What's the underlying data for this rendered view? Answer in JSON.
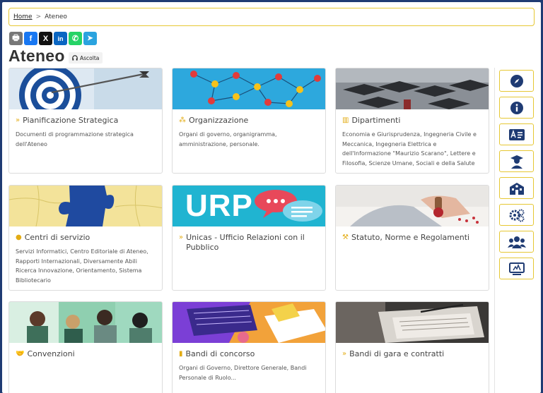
{
  "breadcrumb": {
    "home": "Home",
    "separator": ">",
    "current": "Ateneo"
  },
  "share": [
    {
      "icon": "print-icon",
      "glyph": "🖶",
      "color": "#777777"
    },
    {
      "icon": "facebook-icon",
      "glyph": "f",
      "color": "#1877f2"
    },
    {
      "icon": "x-icon",
      "glyph": "X",
      "color": "#111111"
    },
    {
      "icon": "linkedin-icon",
      "glyph": "in",
      "color": "#0a66c2"
    },
    {
      "icon": "whatsapp-icon",
      "glyph": "✆",
      "color": "#25d366"
    },
    {
      "icon": "telegram-icon",
      "glyph": "➤",
      "color": "#2aa3df"
    }
  ],
  "page_title": "Ateneo",
  "listen_label": "Ascolta",
  "cards": [
    {
      "title": "Pianificazione Strategica",
      "icon": "double-chevron-icon",
      "desc": "Documenti di programmazione strategica dell'Ateneo"
    },
    {
      "title": "Organizzazione",
      "icon": "sitemap-icon",
      "desc": "Organi di governo, organigramma, amministrazione, personale."
    },
    {
      "title": "Dipartimenti",
      "icon": "building-icon",
      "desc": "Economia e Giurisprudenza, Ingegneria Civile e Meccanica, Ingegneria Elettrica e dell'Informazione \"Maurizio Scarano\", Lettere e Filosofia, Scienze Umane, Sociali e della Salute"
    },
    {
      "title": "Centri di servizio",
      "icon": "coin-icon",
      "desc": "Servizi Informatici, Centro Editoriale di Ateneo, Rapporti Internazionali, Diversamente Abili Ricerca Innovazione, Orientamento, Sistema Bibliotecario"
    },
    {
      "title": "Unicas - Ufficio Relazioni con il Pubblico",
      "icon": "double-chevron-icon",
      "desc": ""
    },
    {
      "title": "Statuto, Norme e Regolamenti",
      "icon": "gavel-icon",
      "desc": ""
    },
    {
      "title": "Convenzioni",
      "icon": "handshake-icon",
      "desc": ""
    },
    {
      "title": "Bandi di concorso",
      "icon": "book-icon",
      "desc": "Organi di Governo, Direttore Generale, Bandi Personale di Ruolo..."
    },
    {
      "title": "Bandi di gara e contratti",
      "icon": "double-chevron-icon",
      "desc": ""
    }
  ],
  "urp_logo_text": "URP",
  "rail": [
    {
      "icon": "compass-icon"
    },
    {
      "icon": "info-icon"
    },
    {
      "icon": "id-card-icon"
    },
    {
      "icon": "graduate-icon"
    },
    {
      "icon": "school-icon"
    },
    {
      "icon": "settings-icon"
    },
    {
      "icon": "users-icon"
    },
    {
      "icon": "monitor-icon"
    }
  ],
  "colors": {
    "accent": "#e6c733",
    "rail_icon": "#1f3b73",
    "frame": "#1f3b73",
    "card_icon": "#e3ac14"
  }
}
